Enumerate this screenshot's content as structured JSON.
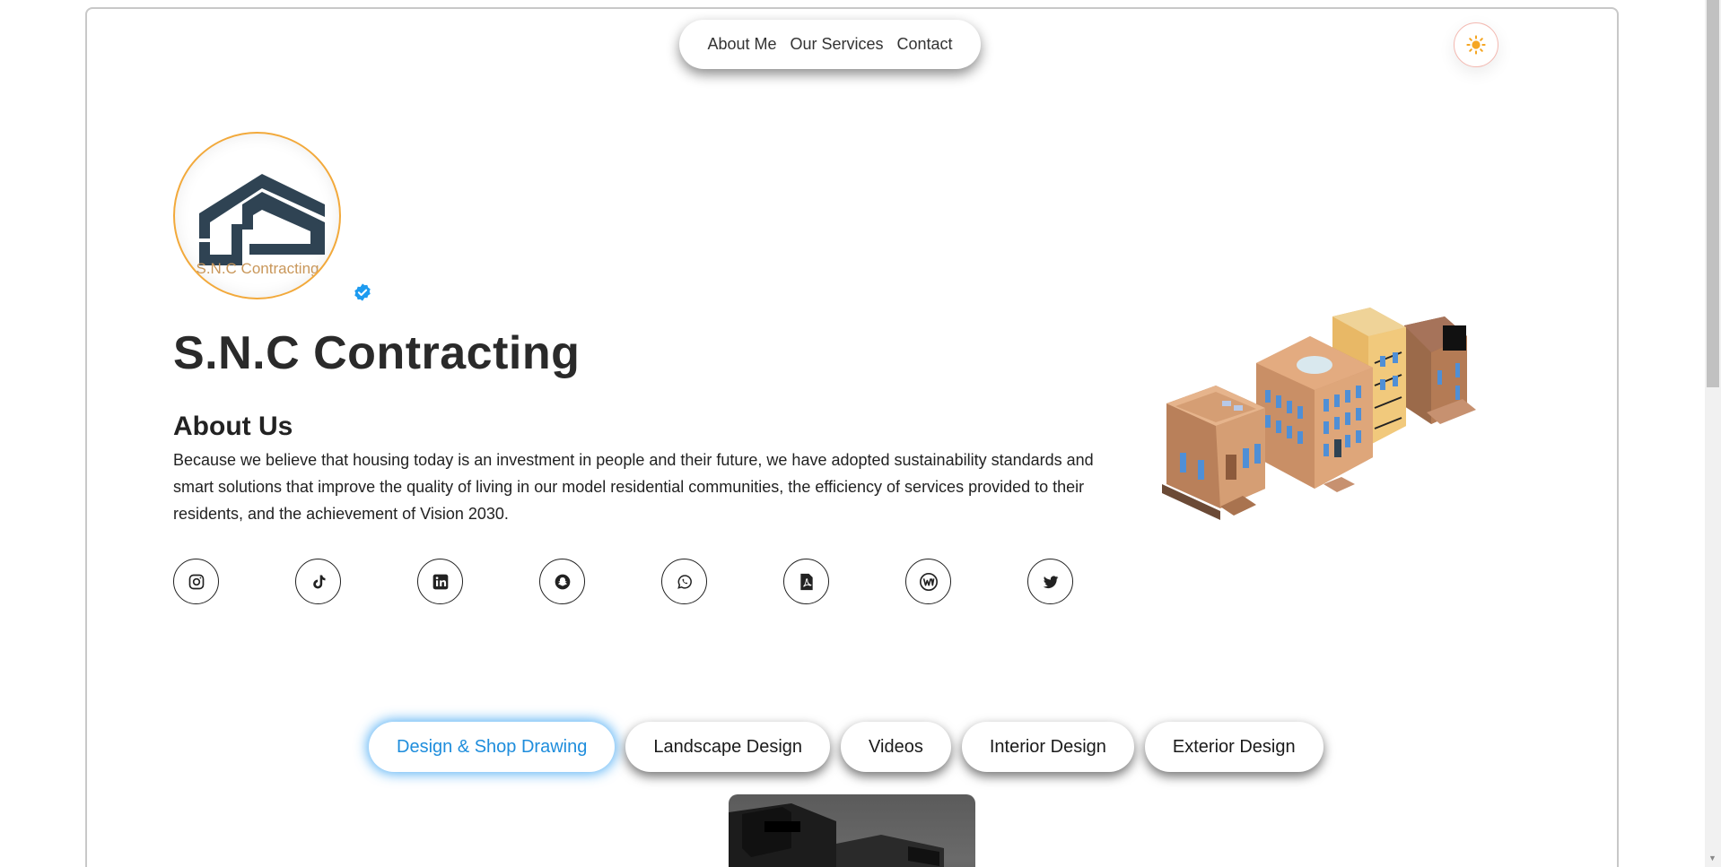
{
  "nav": {
    "items": [
      "About Me",
      "Our Services",
      "Contact"
    ]
  },
  "theme_toggle": {
    "icon": "sun-icon",
    "color": "#f5a623"
  },
  "profile": {
    "logo_text": "S.N.C Contracting",
    "name": "S.N.C Contracting",
    "verified_icon": "verified-badge-icon",
    "verified_color": "#1d9bf0"
  },
  "about": {
    "title": "About Us",
    "text": "Because we believe that housing today is an investment in people and their future, we have adopted sustainability standards and smart solutions that improve the quality of living in our model residential communities, the efficiency of services provided to their residents, and the achievement of Vision 2030."
  },
  "socials": [
    {
      "name": "instagram-icon"
    },
    {
      "name": "tiktok-icon"
    },
    {
      "name": "linkedin-icon"
    },
    {
      "name": "snapchat-icon"
    },
    {
      "name": "whatsapp-icon"
    },
    {
      "name": "pdf-icon"
    },
    {
      "name": "wix-icon"
    },
    {
      "name": "twitter-icon"
    }
  ],
  "tabs": {
    "items": [
      "Design & Shop Drawing",
      "Landscape Design",
      "Videos",
      "Interior Design",
      "Exterior Design"
    ],
    "active_index": 0,
    "active_color": "#1e8ddc"
  }
}
